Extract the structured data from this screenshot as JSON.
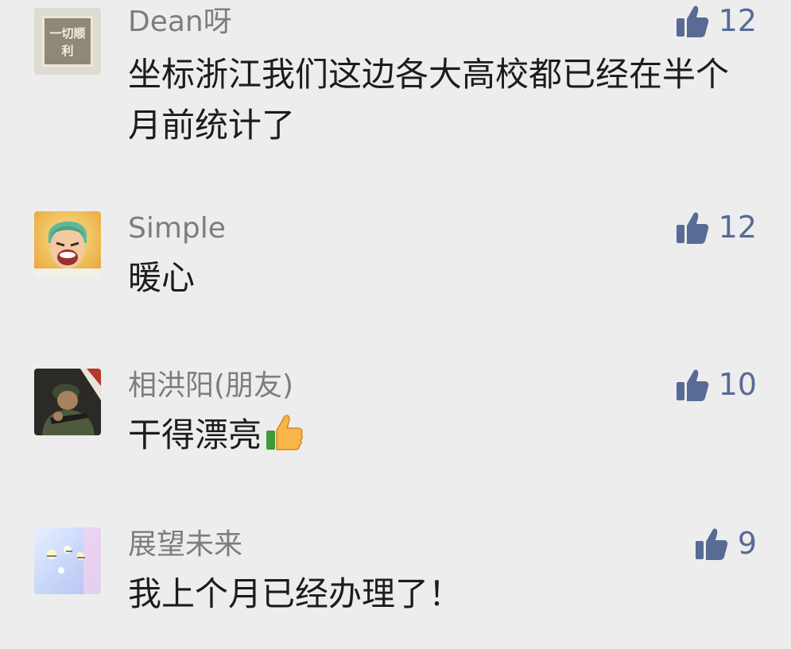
{
  "comments": [
    {
      "name": "Dean呀",
      "text": "坐标浙江我们这边各大高校都已经在半个月前统计了",
      "likes": "12",
      "avatar": "avatar-plaque",
      "avatar_text": "一切顺利"
    },
    {
      "name": "Simple",
      "text": "暖心",
      "likes": "12",
      "avatar": "avatar-anime-character"
    },
    {
      "name": "相洪阳(朋友)",
      "text": "干得漂亮",
      "likes": "10",
      "avatar": "avatar-soldier",
      "emoji": "thumbs-up-emoji"
    },
    {
      "name": "展望未来",
      "text": "我上个月已经办理了！",
      "likes": "9",
      "avatar": "avatar-pastel-fireworks"
    }
  ],
  "colors": {
    "background": "#ededed",
    "name": "#7d7d7d",
    "text": "#1c1c1c",
    "like": "#576b95"
  }
}
